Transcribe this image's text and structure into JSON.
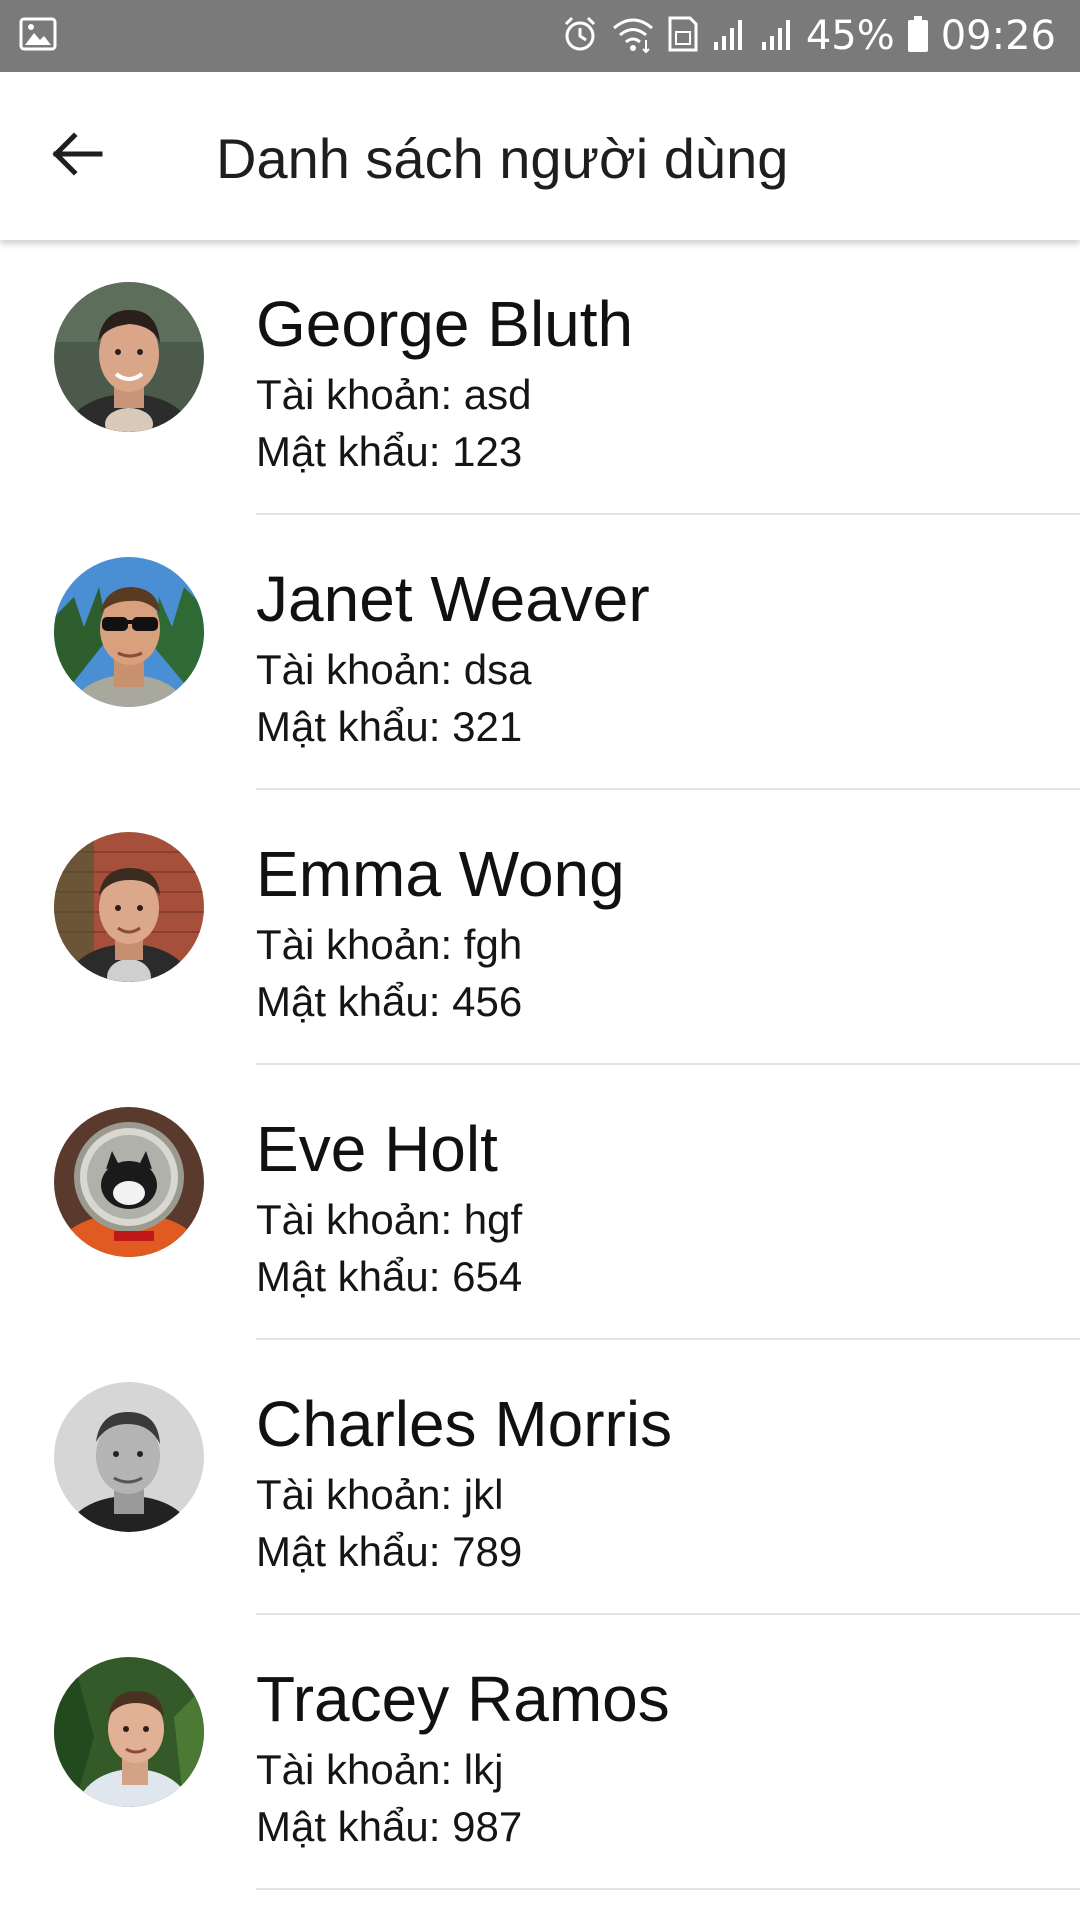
{
  "status_bar": {
    "battery": "45%",
    "time": "09:26",
    "icons": [
      "image-icon",
      "alarm-icon",
      "wifi-icon",
      "sim-icon",
      "signal-icon",
      "signal-icon",
      "battery-icon"
    ]
  },
  "app_bar": {
    "title": "Danh sách người dùng",
    "back_icon": "back-arrow-icon"
  },
  "users": [
    {
      "name": "George Bluth",
      "account": "Tài khoản: asd",
      "password": "Mật khẩu: 123",
      "avatar": "man-smiling-forest"
    },
    {
      "name": "Janet Weaver",
      "account": "Tài khoản: dsa",
      "password": "Mật khẩu: 321",
      "avatar": "man-sunglasses"
    },
    {
      "name": "Emma Wong",
      "account": "Tài khoản: fgh",
      "password": "Mật khẩu: 456",
      "avatar": "man-brick-wall"
    },
    {
      "name": "Eve Holt",
      "account": "Tài khoản: hgf",
      "password": "Mật khẩu: 654",
      "avatar": "cat-astronaut"
    },
    {
      "name": "Charles Morris",
      "account": "Tài khoản: jkl",
      "password": "Mật khẩu: 789",
      "avatar": "man-grayscale"
    },
    {
      "name": "Tracey Ramos",
      "account": "Tài khoản: lkj",
      "password": "Mật khẩu: 987",
      "avatar": "man-outdoors"
    }
  ],
  "colors": {
    "status_bar_bg": "#7a7a7a",
    "app_bar_bg": "#ffffff",
    "text_primary": "#111111",
    "divider": "#e4e4e4"
  }
}
